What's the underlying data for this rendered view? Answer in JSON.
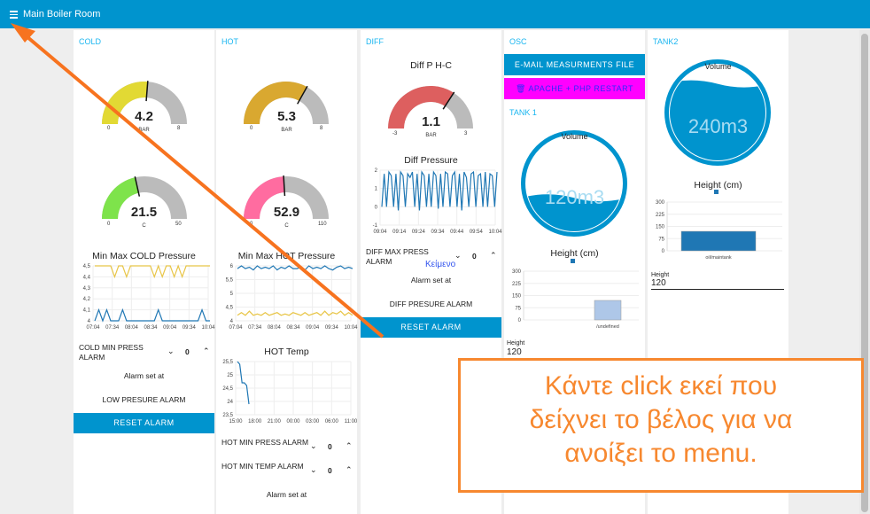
{
  "header": {
    "title": "Main Boiler Room",
    "menu_icon": "hamburger-icon",
    "color": "#0094ce"
  },
  "cold": {
    "group": "COLD",
    "pressure_gauge": {
      "value": "4.2",
      "unit": "BAR",
      "min": "0",
      "max": "8",
      "color": "#e2d934"
    },
    "temp_gauge": {
      "value": "21.5",
      "unit": "C",
      "min": "0",
      "max": "50",
      "color": "#7ee34b"
    },
    "chart_title": "Min Max COLD Pressure",
    "alarm_label": "COLD MIN PRESS ALARM",
    "alarm_value": "0",
    "alarm_set": "Alarm set at",
    "alarm_text": "LOW PRESURE ALARM",
    "reset": "RESET ALARM"
  },
  "hot": {
    "group": "HOT",
    "pressure_gauge": {
      "value": "5.3",
      "unit": "BAR",
      "min": "0",
      "max": "8",
      "color": "#d9a830"
    },
    "temp_gauge": {
      "value": "52.9",
      "unit": "C",
      "min": "0",
      "max": "110",
      "color": "#ff6ca0"
    },
    "chart_title": "Min Max HOT Pressure",
    "temp_chart_title": "HOT Temp",
    "press_alarm_label": "HOT MIN PRESS ALARM",
    "press_alarm_value": "0",
    "temp_alarm_label": "HOT MIN TEMP ALARM",
    "temp_alarm_value": "0",
    "alarm_set": "Alarm set at"
  },
  "diff": {
    "group": "DIFF",
    "gauge_title": "Diff P H-C",
    "gauge": {
      "value": "1.1",
      "unit": "BAR",
      "min": "-3",
      "max": "3",
      "color": "#dd5f5f"
    },
    "chart_title": "Diff Pressure",
    "alarm_label": "DIFF MAX PRESS ALARM",
    "alarm_value": "0",
    "overlay_text": "Κείμενο",
    "alarm_set": "Alarm set at",
    "alarm_text": "DIFF PRESURE ALARM",
    "reset": "RESET ALARM"
  },
  "osc": {
    "group": "OSC",
    "email_button": "E-MAIL MEASURMENTS FILE",
    "restart_button": "APACHE + PHP RESTART",
    "restart_icon": "trash-icon",
    "restart_color": "#ff00ff"
  },
  "tank1": {
    "group": "TANK 1",
    "volume_label": "Volume",
    "volume": "120m3",
    "fill_fraction": 0.35,
    "height_title": "Height (cm)",
    "height_label": "Height",
    "height_value": "120"
  },
  "tank2": {
    "group": "TANK2",
    "volume_label": "Volume",
    "volume": "240m3",
    "fill_fraction": 0.8,
    "height_title": "Height (cm)",
    "height_label": "Height",
    "height_value": "120"
  },
  "annotation": {
    "text_lines": [
      "Κάντε click εκεί που",
      "δείχνει το βέλος για να",
      "ανοίξει το menu."
    ],
    "color": "#f7882f"
  },
  "chart_data": [
    {
      "type": "line",
      "title": "Min Max COLD Pressure",
      "xticks": [
        "07:04",
        "07:34",
        "08:04",
        "08:34",
        "09:04",
        "09:34",
        "10:04"
      ],
      "yticks": [
        "4",
        "4,1",
        "4,2",
        "4,3",
        "4,4",
        "4,5"
      ],
      "ylim": [
        4,
        4.5
      ],
      "series": [
        {
          "color": "#e8c547",
          "values": [
            4.5,
            4.5,
            4.5,
            4.5,
            4.5,
            4.4,
            4.5,
            4.5,
            4.4,
            4.5,
            4.5,
            4.5,
            4.5,
            4.5,
            4.5,
            4.4,
            4.5,
            4.4,
            4.5,
            4.5,
            4.4,
            4.5,
            4.4,
            4.5,
            4.5,
            4.5,
            4.5,
            4.5,
            4.5,
            4.5
          ]
        },
        {
          "color": "#1f77b4",
          "values": [
            4,
            4.1,
            4,
            4.1,
            4,
            4,
            4,
            4.1,
            4,
            4,
            4,
            4,
            4,
            4,
            4,
            4,
            4.1,
            4,
            4,
            4,
            4,
            4,
            4,
            4,
            4,
            4,
            4,
            4.1,
            4,
            4
          ]
        }
      ]
    },
    {
      "type": "line",
      "title": "Min Max HOT Pressure",
      "xticks": [
        "07:04",
        "07:34",
        "08:04",
        "08:34",
        "09:04",
        "09:34",
        "10:04"
      ],
      "yticks": [
        "4",
        "4,5",
        "5",
        "5,5",
        "6"
      ],
      "ylim": [
        4,
        6
      ],
      "series": [
        {
          "color": "#1f77b4",
          "values": [
            5.9,
            6,
            5.9,
            5.95,
            5.85,
            6,
            5.9,
            5.95,
            5.9,
            6,
            5.85,
            5.95,
            5.9,
            6,
            5.9,
            5.9,
            5.95,
            5.85,
            6,
            5.9,
            5.95,
            5.9,
            6,
            5.9,
            5.85,
            5.95,
            6,
            5.9,
            5.95,
            5.9
          ]
        },
        {
          "color": "#e8c547",
          "values": [
            4.2,
            4.3,
            4.2,
            4.35,
            4.2,
            4.25,
            4.2,
            4.3,
            4.2,
            4.25,
            4.3,
            4.2,
            4.25,
            4.2,
            4.3,
            4.25,
            4.2,
            4.3,
            4.2,
            4.25,
            4.3,
            4.2,
            4.35,
            4.2,
            4.3,
            4.25,
            4.35,
            4.2,
            4.3,
            4.2
          ]
        }
      ]
    },
    {
      "type": "line",
      "title": "HOT Temp",
      "xticks": [
        "15:00",
        "18:00",
        "21:00",
        "00:00",
        "03:00",
        "06:00",
        "11:00"
      ],
      "yticks": [
        "23,5",
        "24",
        "24,5",
        "25",
        "25,5"
      ],
      "ylim": [
        23.5,
        25.5
      ],
      "series": [
        {
          "color": "#1f77b4",
          "values": [
            25.5,
            25.4,
            24.7,
            24.7,
            24.6,
            23.9
          ]
        }
      ]
    },
    {
      "type": "line",
      "title": "Diff Pressure",
      "xticks": [
        "09:04",
        "09:14",
        "09:24",
        "09:34",
        "09:44",
        "09:54",
        "10:04"
      ],
      "yticks": [
        "-1",
        "0",
        "1",
        "2"
      ],
      "ylim": [
        -1,
        2
      ],
      "series": [
        {
          "color": "#1f77b4",
          "values": [
            0,
            1.8,
            0,
            1.9,
            1.7,
            0,
            1.8,
            -0.2,
            1.9,
            1.7,
            0,
            1.8,
            1.6,
            1.9,
            0,
            1.8,
            -0.2,
            1.9,
            1.7,
            0,
            1.8,
            0,
            1.9,
            1.7,
            -0.1,
            1.8,
            0,
            1.9,
            1.8,
            0,
            1.7,
            1.9,
            0,
            1.8,
            -0.2,
            1.9,
            1.6,
            0,
            1.8,
            1.9,
            0,
            1.7,
            1.8,
            0,
            1.9,
            0,
            1.8,
            1.7,
            0,
            1.9
          ]
        }
      ]
    },
    {
      "type": "bar",
      "title": "Height (cm)",
      "categories": [
        "/undefined"
      ],
      "values": [
        120
      ],
      "yticks": [
        "0",
        "75",
        "150",
        "225",
        "300"
      ],
      "ylim": [
        0,
        300
      ],
      "color": "#aec7e8"
    },
    {
      "type": "bar",
      "title": "Height (cm)",
      "categories": [
        "oil/maintank"
      ],
      "values": [
        120
      ],
      "yticks": [
        "0",
        "75",
        "150",
        "225",
        "300"
      ],
      "ylim": [
        0,
        300
      ],
      "color": "#1f77b4"
    }
  ]
}
